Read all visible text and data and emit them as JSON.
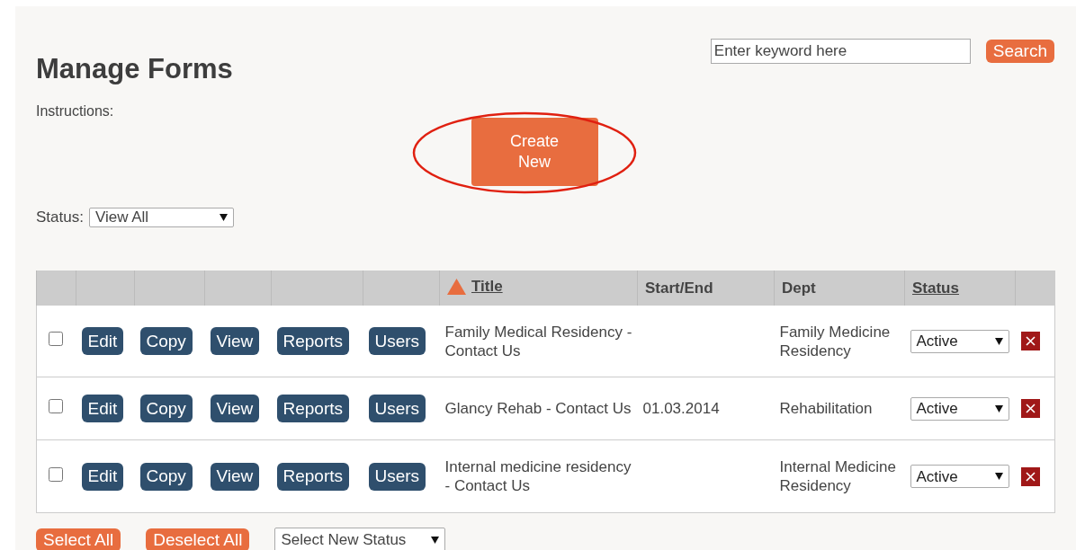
{
  "page": {
    "title": "Manage Forms",
    "instructions": "Instructions:"
  },
  "search": {
    "placeholder": "Enter keyword here",
    "button": "Search"
  },
  "create_button": {
    "label": "Create New",
    "highlighted": true
  },
  "status_filter": {
    "label": "Status:",
    "value": "View All"
  },
  "table": {
    "columns": [
      {},
      {},
      {},
      {},
      {},
      {},
      {
        "label": "Title",
        "sortable": true,
        "sorted_ascending": true
      },
      {
        "label": "Start/End",
        "sortable": false
      },
      {
        "label": "Dept",
        "sortable": false
      },
      {
        "label": "Status",
        "sortable": true
      },
      {}
    ],
    "rows": [
      {
        "checked": false,
        "actions": [
          "Edit",
          "Copy",
          "View",
          "Reports",
          "Users"
        ],
        "title": "Family Medical Residency - Contact Us",
        "dept": "Family Medicine Residency",
        "status": "Active"
      },
      {
        "checked": false,
        "actions": [
          "Edit",
          "Copy",
          "View",
          "Reports",
          "Users"
        ],
        "title": "Glancy Rehab - Contact Us",
        "start_end": "01.03.2014",
        "dept": "Rehabilitation",
        "status": "Active"
      },
      {
        "checked": false,
        "actions": [
          "Edit",
          "Copy",
          "View",
          "Reports",
          "Users"
        ],
        "title": "Internal medicine residency - Contact Us",
        "dept": "Internal Medicine Residency",
        "status": "Active"
      }
    ]
  },
  "footer": {
    "buttons": [
      "Select All",
      "Deselect All"
    ],
    "status_select": "Select New Status"
  }
}
